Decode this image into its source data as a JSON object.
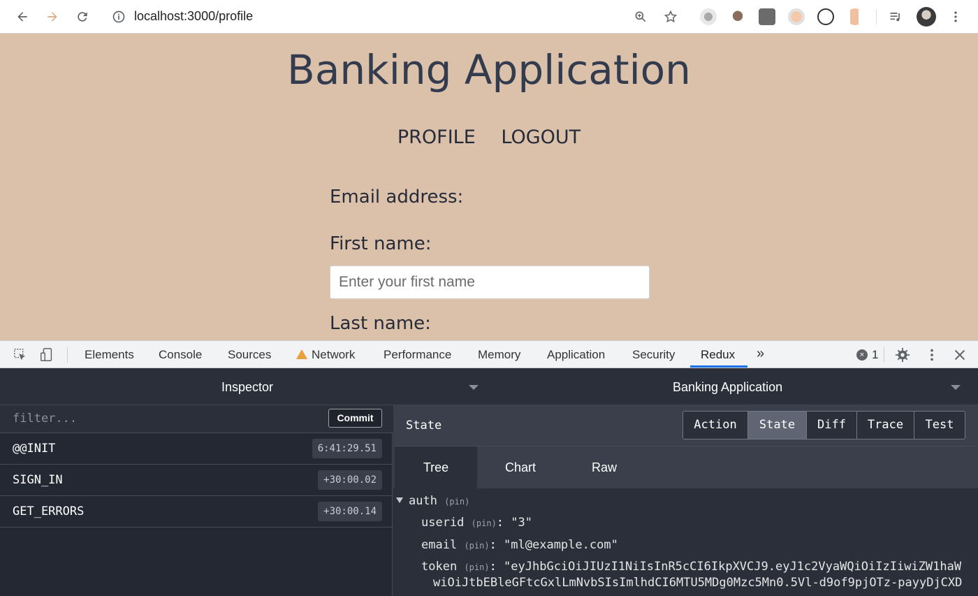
{
  "browser": {
    "url_host": "localhost",
    "url_path": ":3000/profile"
  },
  "page": {
    "app_title": "Banking Application",
    "nav": {
      "profile": "PROFILE",
      "logout": "LOGOUT"
    },
    "form": {
      "email_label": "Email address:",
      "first_name_label": "First name:",
      "first_name_placeholder": "Enter your first name",
      "last_name_label": "Last name:"
    }
  },
  "devtools": {
    "tabs": [
      "Elements",
      "Console",
      "Sources",
      "Network",
      "Performance",
      "Memory",
      "Application",
      "Security",
      "Redux"
    ],
    "active_tab": "Redux",
    "more": "»",
    "error_count": "1"
  },
  "redux": {
    "left_title": "Inspector",
    "right_title": "Banking Application",
    "filter_placeholder": "filter...",
    "commit_label": "Commit",
    "actions": [
      {
        "name": "@@INIT",
        "time": "6:41:29.51"
      },
      {
        "name": "SIGN_IN",
        "time": "+30:00.02"
      },
      {
        "name": "GET_ERRORS",
        "time": "+30:00.14"
      }
    ],
    "panel_label": "State",
    "segments": [
      "Action",
      "State",
      "Diff",
      "Trace",
      "Test"
    ],
    "active_segment": "State",
    "subtabs": [
      "Tree",
      "Chart",
      "Raw"
    ],
    "active_subtab": "Tree",
    "tree": {
      "root_key": "auth",
      "pin": "(pin)",
      "userid_key": "userid",
      "userid_value": "\"3\"",
      "email_key": "email",
      "email_value": "\"ml@example.com\"",
      "token_key": "token",
      "token_value_line1": "\"eyJhbGciOiJIUzI1NiIsInR5cCI6IkpXVCJ9.eyJ1c2VyaWQiOiIzIiwiZW1haW",
      "token_value_line2": "wiOiJtbEBleGFtcGxlLmNvbSIsImlhdCI6MTU5MDg0Mzc5Mn0.5Vl-d9of9pjOTz-payyDjCXD"
    }
  },
  "colors": {
    "page_bg": "#dcc1aa",
    "title_color": "#333c4e",
    "redux_bg": "#2a2f3a",
    "devtools_active_underline": "#1a73e8"
  }
}
